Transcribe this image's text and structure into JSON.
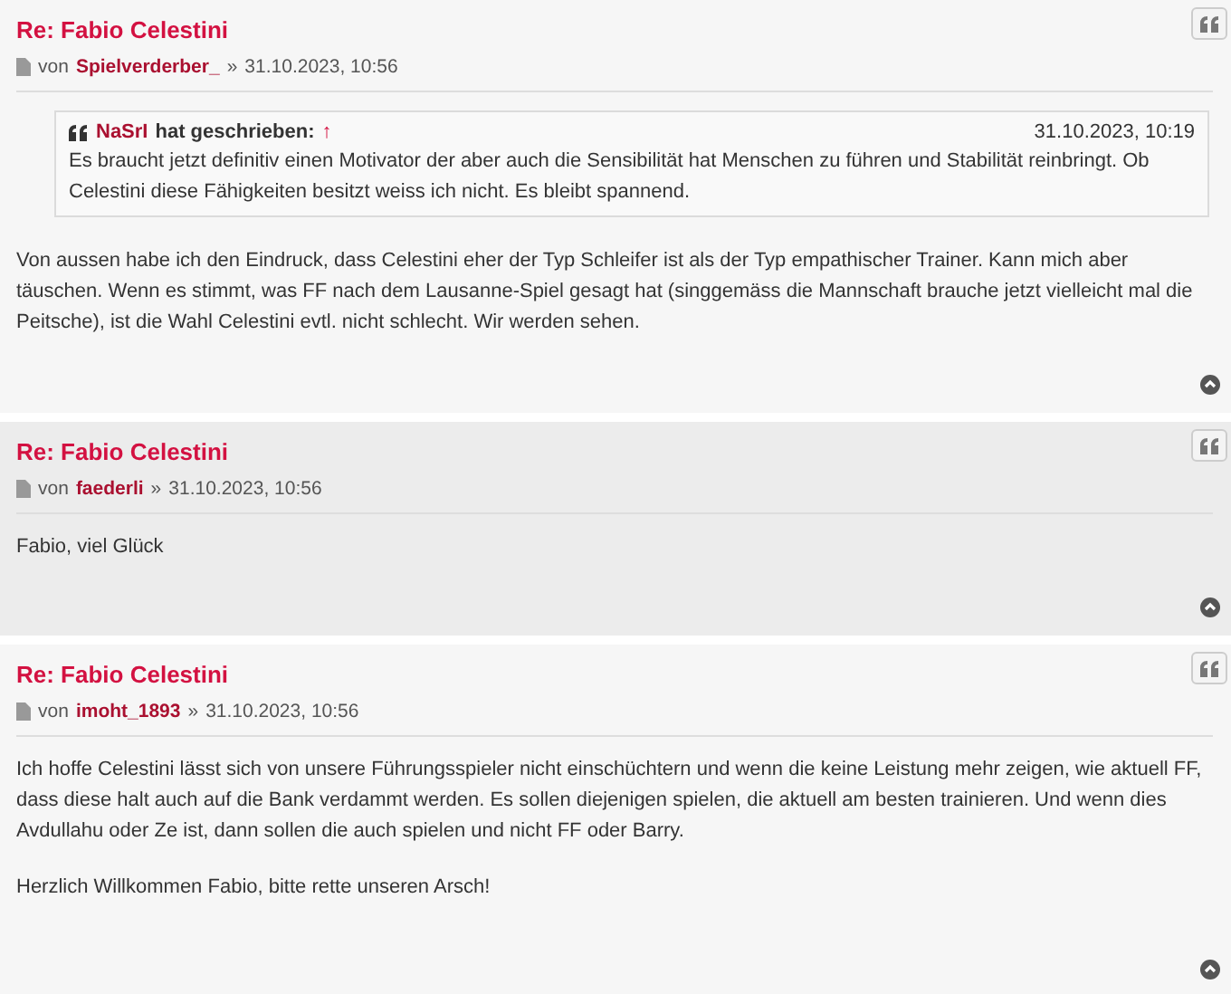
{
  "posts": [
    {
      "title": "Re: Fabio Celestini",
      "by": "von",
      "author": "Spielverderber_",
      "sep": "»",
      "date": "31.10.2023, 10:56",
      "body": [
        {
          "kind": "quote",
          "author": "NaSrI",
          "verb": "hat geschrieben:",
          "jump": "↑",
          "date": "31.10.2023, 10:19",
          "text": "Es braucht jetzt definitiv einen Motivator der aber auch die Sensibilität hat Menschen zu führen und Stabilität reinbringt. Ob Celestini diese Fähigkeiten besitzt weiss ich nicht. Es bleibt spannend."
        },
        {
          "kind": "text",
          "text": "Von aussen habe ich den Eindruck, dass Celestini eher der Typ Schleifer ist als der Typ empathischer Trainer. Kann mich aber täuschen. Wenn es stimmt, was FF nach dem Lausanne-Spiel gesagt hat (singgemäss die Mannschaft brauche jetzt vielleicht mal die Peitsche), ist die Wahl Celestini evtl. nicht schlecht. Wir werden sehen."
        }
      ]
    },
    {
      "title": "Re: Fabio Celestini",
      "by": "von",
      "author": "faederli",
      "sep": "»",
      "date": "31.10.2023, 10:56",
      "body": [
        {
          "kind": "text",
          "text": "Fabio, viel Glück"
        }
      ]
    },
    {
      "title": "Re: Fabio Celestini",
      "by": "von",
      "author": "imoht_1893",
      "sep": "»",
      "date": "31.10.2023, 10:56",
      "body": [
        {
          "kind": "text",
          "text": "Ich hoffe Celestini lässt sich von unsere Führungsspieler nicht einschüchtern und wenn die keine Leistung mehr zeigen, wie aktuell FF, dass diese halt auch auf die Bank verdammt werden.  Es sollen diejenigen spielen, die aktuell am besten trainieren. Und wenn dies Avdullahu oder Ze ist, dann sollen die auch spielen und nicht FF oder Barry."
        },
        {
          "kind": "text",
          "text": "Herzlich Willkommen Fabio, bitte rette unseren Arsch!"
        }
      ]
    }
  ]
}
